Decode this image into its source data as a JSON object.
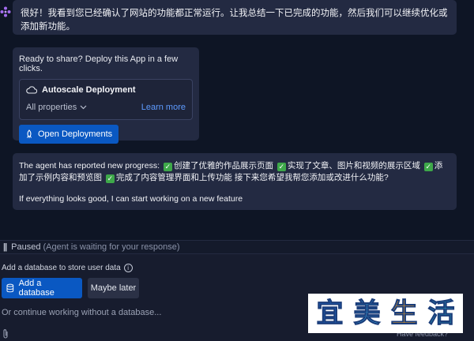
{
  "messages": {
    "first": "很好！我看到您已经确认了网站的功能都正常运行。让我总结一下已完成的功能，然后我们可以继续优化或添加新功能。",
    "progress_prefix": "The agent has reported new progress:",
    "progress_items": [
      "创建了优雅的作品展示页面",
      "实现了文章、图片和视频的展示区域",
      "添加了示例内容和预览图",
      "完成了内容管理界面和上传功能"
    ],
    "progress_suffix": "接下来您希望我帮您添加或改进什么功能?",
    "progress_second": "If everything looks good, I can start working on a new feature"
  },
  "deploy": {
    "ready_text": "Ready to share? Deploy this App in a few clicks.",
    "deployment_type": "Autoscale Deployment",
    "properties_label": "All properties",
    "learn_more": "Learn more",
    "open_button": "Open Deployments"
  },
  "status": {
    "paused_label": "Paused",
    "paused_detail": "(Agent is waiting for your response)"
  },
  "database": {
    "prompt": "Add a database to store user data",
    "add_button": "Add a database",
    "later_button": "Maybe later",
    "continue_text": "Or continue working without a database..."
  },
  "footer": {
    "feedback": "Have feedback?"
  },
  "watermark": {
    "chars": [
      "宜",
      "美",
      "生",
      "活"
    ],
    "colors": [
      "#1e6fd0",
      "#3aa8e0",
      "#f0a020",
      "#2bb5c8"
    ]
  },
  "colors": {
    "accent": "#0a58c2",
    "link": "#5e9bff",
    "check": "#3ea84a",
    "background": "#0e1525",
    "bubble": "#232a42"
  }
}
